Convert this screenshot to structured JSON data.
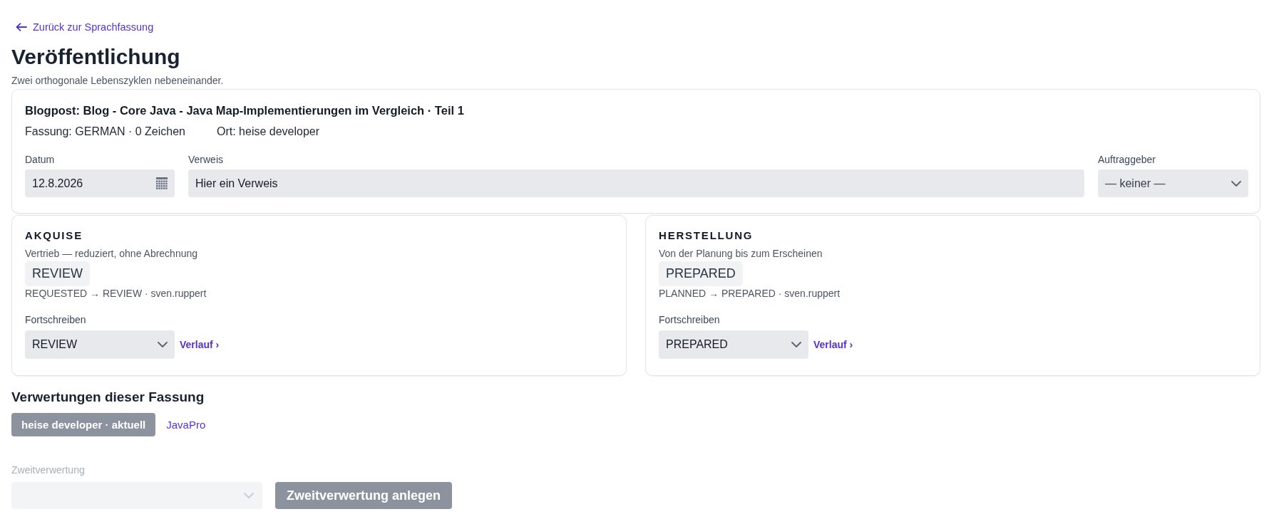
{
  "back_link": {
    "label": "Zurück zur Sprachfassung"
  },
  "page": {
    "title": "Veröffentlichung",
    "subtitle": "Zwei orthogonale Lebenszyklen nebeneinander."
  },
  "publication": {
    "title": "Blogpost: Blog - Core Java - Java Map-Implementierungen im Vergleich · Teil 1",
    "meta": [
      "Fassung: GERMAN · 0 Zeichen",
      "Ort: heise developer"
    ],
    "fields": [
      {
        "kind": "date",
        "label": "Datum",
        "value": "12.8.2026"
      },
      {
        "kind": "text",
        "label": "Verweis",
        "value": "Hier ein Verweis"
      },
      {
        "kind": "select",
        "label": "Auftraggeber",
        "value": "— keiner —"
      }
    ]
  },
  "lifecycles": [
    {
      "title": "AKQUISE",
      "description": "Vertrieb — reduziert, ohne Abrechnung",
      "state": "REVIEW",
      "transition": "REQUESTED → REVIEW · sven.ruppert",
      "field_label": "Fortschreiben",
      "value": "REVIEW",
      "history_link": "Verlauf ›"
    },
    {
      "title": "HERSTELLUNG",
      "description": "Von der Planung bis zum Erscheinen",
      "state": "PREPARED",
      "transition": "PLANNED → PREPARED · sven.ruppert",
      "field_label": "Fortschreiben",
      "value": "PREPARED",
      "history_link": "Verlauf ›"
    }
  ],
  "usages": {
    "title": "Verwertungen dieser Fassung",
    "items": [
      {
        "label": "heise developer · aktuell",
        "selected": true
      },
      {
        "label": "JavaPro",
        "selected": false
      }
    ]
  },
  "secondary": {
    "label": "Zweitverwertung",
    "disabled": true,
    "button": "Zweitverwertung anlegen"
  }
}
